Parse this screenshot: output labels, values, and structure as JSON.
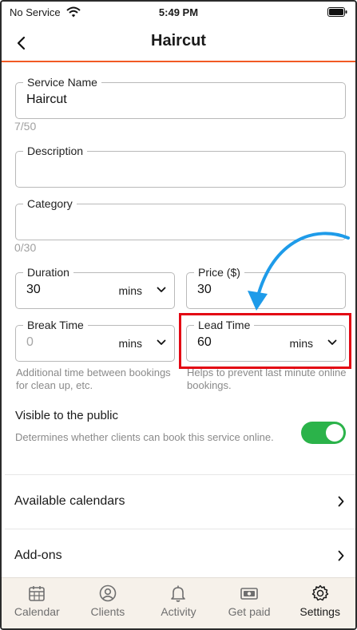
{
  "status_bar": {
    "carrier": "No Service",
    "time": "5:49 PM"
  },
  "nav": {
    "title": "Haircut"
  },
  "form": {
    "service_name": {
      "label": "Service Name",
      "value": "Haircut",
      "counter": "7/50"
    },
    "description": {
      "label": "Description",
      "value": ""
    },
    "category": {
      "label": "Category",
      "value": "",
      "counter": "0/30"
    },
    "duration": {
      "label": "Duration",
      "value": "30",
      "unit": "mins"
    },
    "price": {
      "label": "Price ($)",
      "value": "30"
    },
    "break_time": {
      "label": "Break Time",
      "value": "0",
      "unit": "mins",
      "help": "Additional time between bookings for clean up, etc."
    },
    "lead_time": {
      "label": "Lead Time",
      "value": "60",
      "unit": "mins",
      "help": "Helps to prevent last minute online bookings."
    }
  },
  "visibility": {
    "title": "Visible to the public",
    "description": "Determines whether clients can book this service online.",
    "enabled": true
  },
  "list": {
    "available_calendars": "Available calendars",
    "add_ons": "Add-ons"
  },
  "tabs": [
    {
      "label": "Calendar",
      "icon": "calendar-icon"
    },
    {
      "label": "Clients",
      "icon": "user-circle-icon"
    },
    {
      "label": "Activity",
      "icon": "bell-icon"
    },
    {
      "label": "Get paid",
      "icon": "money-icon"
    },
    {
      "label": "Settings",
      "icon": "gear-icon"
    }
  ],
  "colors": {
    "accent": "#f15a24",
    "toggle_on": "#2bb34a",
    "highlight": "#e30613",
    "annotation_arrow": "#1e9be9"
  }
}
